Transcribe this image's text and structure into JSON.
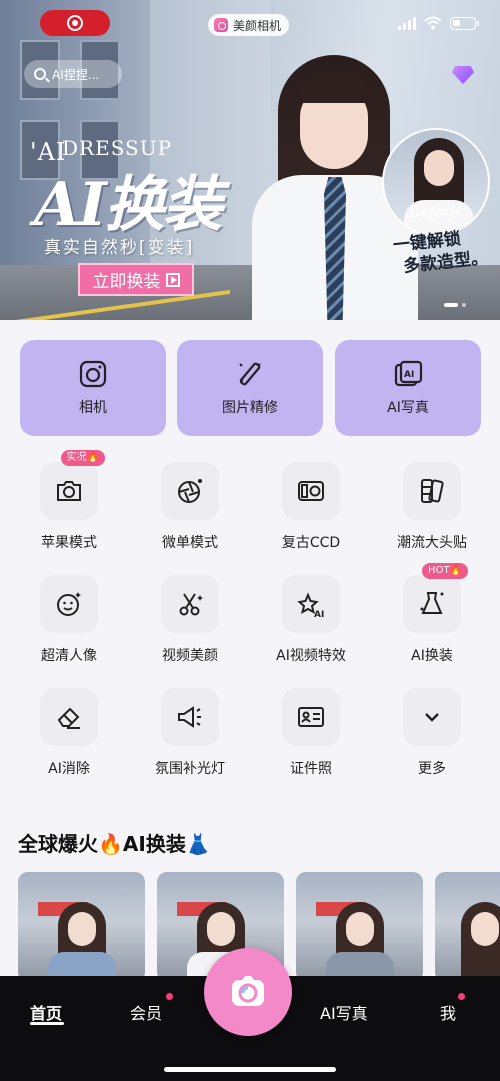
{
  "banner": {
    "search_placeholder": "AI捏捏...",
    "app_label": "美颜相机",
    "ai_mark": "'AI",
    "dressup": "DRESSUP",
    "title": "AI换装",
    "subtitle": "真实自然秒[变装]",
    "cta": "立即换装",
    "before": "Before",
    "unlock_line1": "一键解锁",
    "unlock_line2": "多款造型。"
  },
  "primary": [
    {
      "label": "相机",
      "icon": "camera-icon"
    },
    {
      "label": "图片精修",
      "icon": "magic-wand-icon"
    },
    {
      "label": "AI写真",
      "icon": "ai-portrait-icon"
    }
  ],
  "tools": [
    {
      "label": "苹果模式",
      "tag": "实况🔥"
    },
    {
      "label": "微单模式"
    },
    {
      "label": "复古CCD"
    },
    {
      "label": "潮流大头贴"
    },
    {
      "label": "超清人像"
    },
    {
      "label": "视频美颜"
    },
    {
      "label": "AI视频特效"
    },
    {
      "label": "AI换装",
      "tag": "HOT🔥"
    },
    {
      "label": "AI消除"
    },
    {
      "label": "氛围补光灯"
    },
    {
      "label": "证件照"
    },
    {
      "label": "更多"
    }
  ],
  "section": {
    "title": "全球爆火🔥AI换装👗"
  },
  "nav": {
    "home": "首页",
    "member": "会员",
    "ai_portrait": "AI写真",
    "me": "我"
  },
  "colors": {
    "accent_card": "#c2b3f1",
    "brand_pink": "#f389c9",
    "cta_pink": "#f06ea5",
    "nav_bg": "#0d0d0f"
  }
}
